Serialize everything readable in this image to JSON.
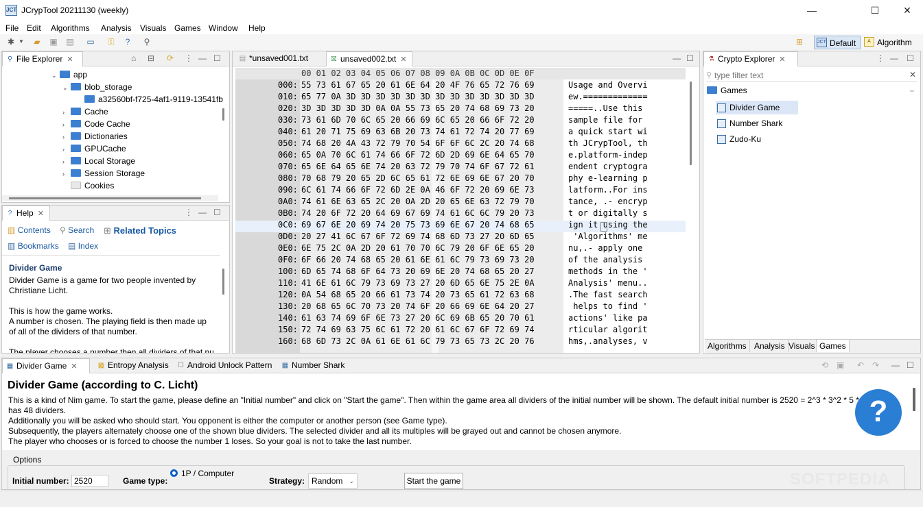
{
  "window": {
    "title": "JCrypTool 20211130 (weekly)",
    "app_icon_text": "JCT",
    "minimize": "—",
    "maximize": "☐",
    "close": "✕"
  },
  "menu": [
    "File",
    "Edit",
    "Algorithms",
    "Analysis",
    "Visuals",
    "Games",
    "Window",
    "Help"
  ],
  "perspectives": {
    "default_label": "Default",
    "algorithm_label": "Algorithm"
  },
  "file_explorer": {
    "tab_label": "File Explorer",
    "items": [
      {
        "label": "app",
        "level": 0,
        "expanded": true
      },
      {
        "label": "blob_storage",
        "level": 1,
        "expanded": true
      },
      {
        "label": "a32560bf-f725-4af1-9119-13541fb",
        "level": 2,
        "expanded": false,
        "leaf": true
      },
      {
        "label": "Cache",
        "level": 1,
        "expanded": false
      },
      {
        "label": "Code Cache",
        "level": 1,
        "expanded": false
      },
      {
        "label": "Dictionaries",
        "level": 1,
        "expanded": false
      },
      {
        "label": "GPUCache",
        "level": 1,
        "expanded": false
      },
      {
        "label": "Local Storage",
        "level": 1,
        "expanded": false
      },
      {
        "label": "Session Storage",
        "level": 1,
        "expanded": false
      },
      {
        "label": "Cookies",
        "level": 1,
        "expanded": false,
        "leaf": true
      }
    ]
  },
  "help": {
    "tab_label": "Help",
    "contents": "Contents",
    "search": "Search",
    "related": "Related Topics",
    "bookmarks": "Bookmarks",
    "index": "Index",
    "heading": "Divider Game",
    "p1": "Divider Game is a game for two people invented by Christiane Licht.",
    "p2": "This is how the game works.",
    "p3": "A number is chosen. The playing field is then made up of all of the dividers of that number.",
    "p4": "The player chooses a number then all dividers of that nu"
  },
  "editor": {
    "tabs": [
      "*unsaved001.txt",
      "unsaved002.txt"
    ],
    "header": "00 01 02 03 04 05 06 07 08 09 0A 0B 0C 0D 0E 0F",
    "rows": [
      {
        "off": "000:",
        "hex": "55 73 61 67 65 20 61 6E 64 20 4F 76 65 72 76 69",
        "ascii": "Usage and Overvi"
      },
      {
        "off": "010:",
        "hex": "65 77 0A 3D 3D 3D 3D 3D 3D 3D 3D 3D 3D 3D 3D 3D",
        "ascii": "ew.============="
      },
      {
        "off": "020:",
        "hex": "3D 3D 3D 3D 3D 0A 0A 55 73 65 20 74 68 69 73 20",
        "ascii": "=====..Use this "
      },
      {
        "off": "030:",
        "hex": "73 61 6D 70 6C 65 20 66 69 6C 65 20 66 6F 72 20",
        "ascii": "sample file for "
      },
      {
        "off": "040:",
        "hex": "61 20 71 75 69 63 6B 20 73 74 61 72 74 20 77 69",
        "ascii": "a quick start wi"
      },
      {
        "off": "050:",
        "hex": "74 68 20 4A 43 72 79 70 54 6F 6F 6C 2C 20 74 68",
        "ascii": "th JCrypTool, th"
      },
      {
        "off": "060:",
        "hex": "65 0A 70 6C 61 74 66 6F 72 6D 2D 69 6E 64 65 70",
        "ascii": "e.platform-indep"
      },
      {
        "off": "070:",
        "hex": "65 6E 64 65 6E 74 20 63 72 79 70 74 6F 67 72 61",
        "ascii": "endent cryptogra"
      },
      {
        "off": "080:",
        "hex": "70 68 79 20 65 2D 6C 65 61 72 6E 69 6E 67 20 70",
        "ascii": "phy e-learning p"
      },
      {
        "off": "090:",
        "hex": "6C 61 74 66 6F 72 6D 2E 0A 46 6F 72 20 69 6E 73",
        "ascii": "latform..For ins"
      },
      {
        "off": "0A0:",
        "hex": "74 61 6E 63 65 2C 20 0A 2D 20 65 6E 63 72 79 70",
        "ascii": "tance, .- encryp"
      },
      {
        "off": "0B0:",
        "hex": "74 20 6F 72 20 64 69 67 69 74 61 6C 6C 79 20 73",
        "ascii": "t or digitally s"
      },
      {
        "off": "0C0:",
        "hex": "69 67 6E 20 69 74 20 75 73 69 6E 67 20 74 68 65",
        "ascii": "ign it using the"
      },
      {
        "off": "0D0:",
        "hex": "20 27 41 6C 67 6F 72 69 74 68 6D 73 27 20 6D 65",
        "ascii": " 'Algorithms' me"
      },
      {
        "off": "0E0:",
        "hex": "6E 75 2C 0A 2D 20 61 70 70 6C 79 20 6F 6E 65 20",
        "ascii": "nu,.- apply one "
      },
      {
        "off": "0F0:",
        "hex": "6F 66 20 74 68 65 20 61 6E 61 6C 79 73 69 73 20",
        "ascii": "of the analysis "
      },
      {
        "off": "100:",
        "hex": "6D 65 74 68 6F 64 73 20 69 6E 20 74 68 65 20 27",
        "ascii": "methods in the '"
      },
      {
        "off": "110:",
        "hex": "41 6E 61 6C 79 73 69 73 27 20 6D 65 6E 75 2E 0A",
        "ascii": "Analysis' menu.."
      },
      {
        "off": "120:",
        "hex": "0A 54 68 65 20 66 61 73 74 20 73 65 61 72 63 68",
        "ascii": ".The fast search"
      },
      {
        "off": "130:",
        "hex": "20 68 65 6C 70 73 20 74 6F 20 66 69 6E 64 20 27",
        "ascii": " helps to find '"
      },
      {
        "off": "140:",
        "hex": "61 63 74 69 6F 6E 73 27 20 6C 69 6B 65 20 70 61",
        "ascii": "actions' like pa"
      },
      {
        "off": "150:",
        "hex": "72 74 69 63 75 6C 61 72 20 61 6C 67 6F 72 69 74",
        "ascii": "rticular algorit"
      },
      {
        "off": "160:",
        "hex": "68 6D 73 2C 0A 61 6E 61 6C 79 73 65 73 2C 20 76",
        "ascii": "hms,.analyses, v"
      }
    ]
  },
  "crypto_explorer": {
    "tab_label": "Crypto Explorer",
    "filter_placeholder": "type filter text",
    "category": "Games",
    "items": [
      "Divider Game",
      "Number Shark",
      "Zudo-Ku"
    ],
    "bottom_tabs": [
      "Algorithms",
      "Analysis",
      "Visuals",
      "Games"
    ]
  },
  "bottom": {
    "tabs": [
      "Divider Game",
      "Entropy Analysis",
      "Android Unlock Pattern",
      "Number Shark"
    ],
    "title": "Divider Game (according to C. Licht)",
    "p1": "This is a kind of Nim game. To start the game, please define an \"Initial number\" and click on \"Start the game\". Then within the game area all dividers of the initial number will be shown. The default initial number is 2520 = 2^3 * 3^2 * 5 * 7 which has 48 dividers.",
    "p2": "Additionally you will be asked who should start. You opponent is either the computer or another person (see Game type).",
    "p3": "Subsequently, the players alternately choose one of the shown blue dividers. The selected divider and all its multiples will be grayed out and cannot be chosen anymore.",
    "p4": "The player who chooses or is forced to choose the number 1 loses. So your goal is not to take the last number.",
    "options_label": "Options",
    "initial_number_label": "Initial number:",
    "initial_number_value": "2520",
    "game_type_label": "Game type:",
    "game_type_option": "1P / Computer",
    "strategy_label": "Strategy:",
    "strategy_value": "Random",
    "start_button": "Start the game",
    "help_glyph": "?",
    "watermark": "SOFTPEDIA"
  }
}
